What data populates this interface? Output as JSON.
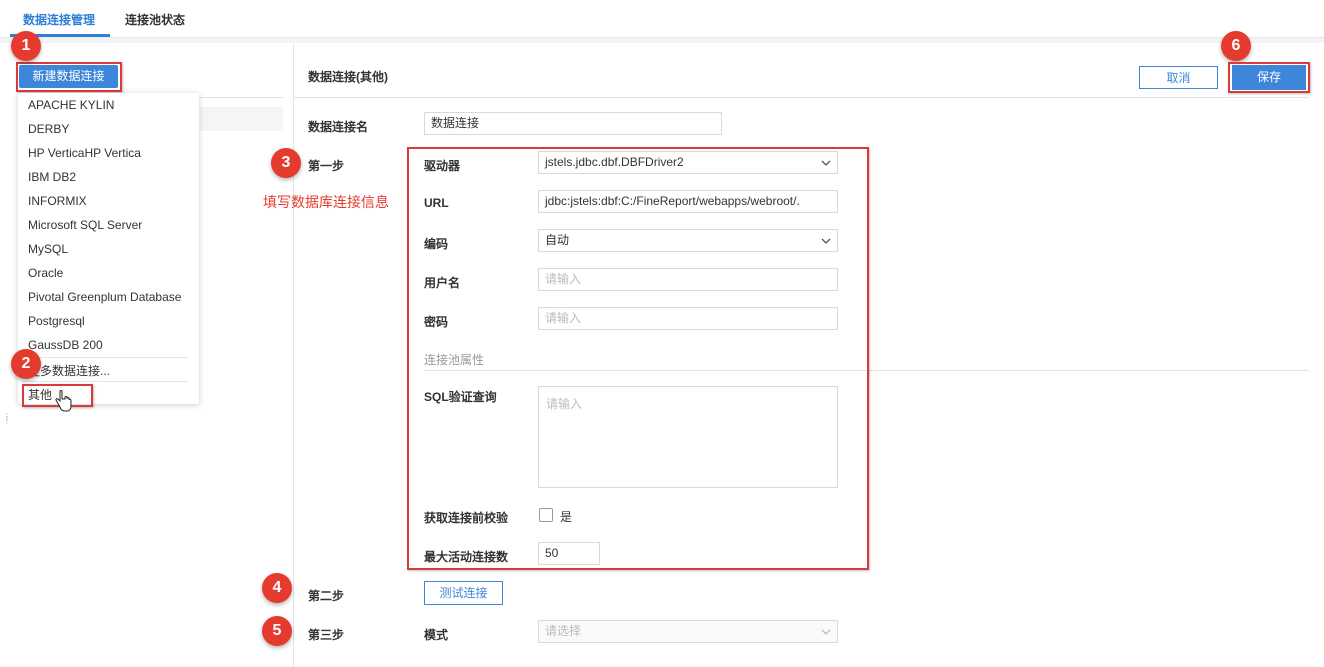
{
  "tabs": [
    {
      "label": "数据连接管理",
      "active": true
    },
    {
      "label": "连接池状态",
      "active": false
    }
  ],
  "left": {
    "new_button": "新建数据连接",
    "dropdown_items": [
      "APACHE KYLIN",
      "DERBY",
      "HP VerticaHP Vertica",
      "IBM DB2",
      "INFORMIX",
      "Microsoft SQL Server",
      "MySQL",
      "Oracle",
      "Pivotal Greenplum Database",
      "Postgresql",
      "GaussDB 200"
    ],
    "more_item": "更多数据连接...",
    "other_item": "其他"
  },
  "panel": {
    "title": "数据连接(其他)",
    "cancel": "取消",
    "save": "保存",
    "conn_name_label": "数据连接名",
    "conn_name_value": "数据连接"
  },
  "steps": {
    "step1": "第一步",
    "step2": "第二步",
    "step3": "第三步"
  },
  "annotation": "填写数据库连接信息",
  "badges": [
    "1",
    "2",
    "3",
    "4",
    "5",
    "6"
  ],
  "form": {
    "driver_label": "驱动器",
    "driver_value": "jstels.jdbc.dbf.DBFDriver2",
    "url_label": "URL",
    "url_value": "jdbc:jstels:dbf:C:/FineReport/webapps/webroot/.",
    "encoding_label": "编码",
    "encoding_value": "自动",
    "user_label": "用户名",
    "user_placeholder": "请输入",
    "password_label": "密码",
    "password_placeholder": "请输入",
    "pool_title": "连接池属性",
    "sql_label": "SQL验证查询",
    "sql_placeholder": "请输入",
    "validate_label": "获取连接前校验",
    "validate_checkbox_label": "是",
    "max_active_label": "最大活动连接数",
    "max_active_value": "50",
    "test_button": "测试连接",
    "mode_label": "模式",
    "mode_placeholder": "请选择"
  },
  "colors": {
    "accent": "#3d86d9",
    "annotation_red": "#e53b2f"
  }
}
